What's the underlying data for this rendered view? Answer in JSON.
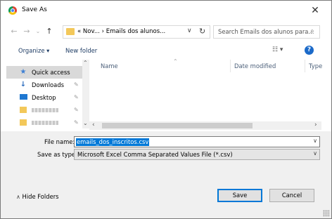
{
  "window": {
    "title": "Save As"
  },
  "nav": {
    "back": "←",
    "forward": "→",
    "dropdown": "⌄",
    "up": "↑",
    "address": "«  Nov...  ›  Emails dos alunos...",
    "address_chevron": "∨",
    "refresh": "↻",
    "search_placeholder": "Search Emails dos alunos para..."
  },
  "toolbar": {
    "organize": "Organize ▾",
    "new_folder": "New folder",
    "view": "☷ ▾",
    "help": "?"
  },
  "sidebar": {
    "items": [
      {
        "label": "Quick access",
        "icon": "star-icon",
        "selected": true
      },
      {
        "label": "Downloads",
        "icon": "download-icon",
        "pinned": true
      },
      {
        "label": "Desktop",
        "icon": "desktop-icon",
        "pinned": true
      },
      {
        "label": "",
        "icon": "folder-icon",
        "pinned": true
      },
      {
        "label": "",
        "icon": "folder-icon",
        "pinned": true
      }
    ]
  },
  "columns": {
    "name": "Name",
    "date_modified": "Date modified",
    "type": "Type"
  },
  "form": {
    "file_name_label": "File name:",
    "file_name_value": "emails_dos_inscritos.csv",
    "save_type_label": "Save as type:",
    "save_type_value": "Microsoft Excel Comma Separated Values File (*.csv)"
  },
  "footer": {
    "hide_folders": "Hide Folders",
    "save": "Save",
    "cancel": "Cancel"
  },
  "colors": {
    "accent": "#0078d7",
    "selected_nav": "#d9d9d9",
    "lower_panel": "#f0f0f0"
  }
}
